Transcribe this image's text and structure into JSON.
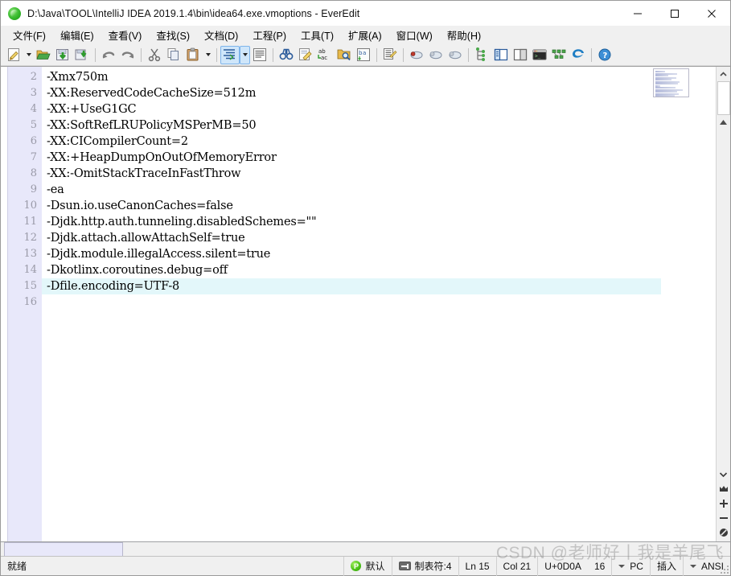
{
  "window": {
    "title": "D:\\Java\\TOOL\\IntelliJ IDEA 2019.1.4\\bin\\idea64.exe.vmoptions - EverEdit",
    "logo_icon": "everedit-green-logo",
    "minimize_label": "─",
    "maximize_label": "□",
    "close_label": "✕"
  },
  "menubar": {
    "items": [
      {
        "label": "文件(F)",
        "name": "menu-file"
      },
      {
        "label": "编辑(E)",
        "name": "menu-edit"
      },
      {
        "label": "查看(V)",
        "name": "menu-view"
      },
      {
        "label": "查找(S)",
        "name": "menu-search"
      },
      {
        "label": "文档(D)",
        "name": "menu-document"
      },
      {
        "label": "工程(P)",
        "name": "menu-project"
      },
      {
        "label": "工具(T)",
        "name": "menu-tools"
      },
      {
        "label": "扩展(A)",
        "name": "menu-extensions"
      },
      {
        "label": "窗口(W)",
        "name": "menu-window"
      },
      {
        "label": "帮助(H)",
        "name": "menu-help"
      }
    ]
  },
  "toolbar": {
    "items": [
      {
        "icon": "new-file-icon",
        "type": "button"
      },
      {
        "icon": "chevron-down-icon",
        "type": "arrow"
      },
      {
        "icon": "open-folder-icon",
        "type": "button"
      },
      {
        "icon": "save-icon",
        "type": "button"
      },
      {
        "icon": "save-as-icon",
        "type": "button"
      },
      {
        "icon": "separator",
        "type": "sep"
      },
      {
        "icon": "undo-icon",
        "type": "button"
      },
      {
        "icon": "redo-icon",
        "type": "button"
      },
      {
        "icon": "separator",
        "type": "sep"
      },
      {
        "icon": "cut-icon",
        "type": "button"
      },
      {
        "icon": "copy-icon",
        "type": "button"
      },
      {
        "icon": "paste-icon",
        "type": "button"
      },
      {
        "icon": "chevron-down-icon",
        "type": "arrow"
      },
      {
        "icon": "separator",
        "type": "sep"
      },
      {
        "icon": "indent-list-icon",
        "type": "button",
        "selected": true
      },
      {
        "icon": "chevron-down-icon",
        "type": "arrow",
        "selected": true
      },
      {
        "icon": "wrap-lines-icon",
        "type": "button"
      },
      {
        "icon": "separator",
        "type": "sep"
      },
      {
        "icon": "find-binoculars-icon",
        "type": "button"
      },
      {
        "icon": "replace-icon",
        "type": "button"
      },
      {
        "icon": "find-replace-abc-icon",
        "type": "button"
      },
      {
        "icon": "find-in-files-icon",
        "type": "button"
      },
      {
        "icon": "sort-ba-icon",
        "type": "button"
      },
      {
        "icon": "separator",
        "type": "sep"
      },
      {
        "icon": "column-mode-icon",
        "type": "button"
      },
      {
        "icon": "separator",
        "type": "sep"
      },
      {
        "icon": "bookmark-add-icon",
        "type": "button"
      },
      {
        "icon": "bookmark-prev-icon",
        "type": "button"
      },
      {
        "icon": "bookmark-next-icon",
        "type": "button"
      },
      {
        "icon": "separator",
        "type": "sep"
      },
      {
        "icon": "outline-tree-icon",
        "type": "button"
      },
      {
        "icon": "explorer-panel-icon",
        "type": "button"
      },
      {
        "icon": "split-panel-icon",
        "type": "button"
      },
      {
        "icon": "console-icon",
        "type": "button"
      },
      {
        "icon": "plugins-icon",
        "type": "button"
      },
      {
        "icon": "browser-icon",
        "type": "button"
      },
      {
        "icon": "separator",
        "type": "sep"
      },
      {
        "icon": "help-icon",
        "type": "button"
      }
    ]
  },
  "editor": {
    "current_line": 15,
    "first_visible_line": 2,
    "lines": [
      {
        "no": "2",
        "text": "-Xmx750m"
      },
      {
        "no": "3",
        "text": "-XX:ReservedCodeCacheSize=512m"
      },
      {
        "no": "4",
        "text": "-XX:+UseG1GC"
      },
      {
        "no": "5",
        "text": "-XX:SoftRefLRUPolicyMSPerMB=50"
      },
      {
        "no": "6",
        "text": "-XX:CICompilerCount=2"
      },
      {
        "no": "7",
        "text": "-XX:+HeapDumpOnOutOfMemoryError"
      },
      {
        "no": "8",
        "text": "-XX:-OmitStackTraceInFastThrow"
      },
      {
        "no": "9",
        "text": "-ea"
      },
      {
        "no": "10",
        "text": "-Dsun.io.useCanonCaches=false"
      },
      {
        "no": "11",
        "text": "-Djdk.http.auth.tunneling.disabledSchemes=\"\""
      },
      {
        "no": "12",
        "text": "-Djdk.attach.allowAttachSelf=true"
      },
      {
        "no": "13",
        "text": "-Djdk.module.illegalAccess.silent=true"
      },
      {
        "no": "14",
        "text": "-Dkotlinx.coroutines.debug=off"
      },
      {
        "no": "15",
        "text": "-Dfile.encoding=UTF-8"
      },
      {
        "no": "16",
        "text": ""
      }
    ]
  },
  "scrollbar": {
    "up_icon": "chevron-up-icon",
    "down_icon": "chevron-down-icon",
    "bookmark_icon": "bookmark-icon",
    "zoom_in_icon": "plus-icon",
    "zoom_out_icon": "minus-icon",
    "reset_icon": "no-entry-icon"
  },
  "tabs": [
    {
      "label": "",
      "name": "doc-tab-vmoptions",
      "active": true
    }
  ],
  "statusbar": {
    "ready_text": "就绪",
    "syntax_icon": "p-green-icon",
    "syntax_label": "默认",
    "tab_icon": "tab-width-icon",
    "tab_label": "制表符:4",
    "line_label": "Ln 15",
    "col_label": "Col 21",
    "unicode_label": "U+0D0A",
    "bytes_label": "16",
    "eol_label": "PC",
    "insert_label": "插入",
    "encoding_label": "ANSI"
  },
  "watermark": {
    "text": "CSDN @老师好丨我是羊尾飞"
  },
  "colors": {
    "gutter_bg": "#e8e8fa",
    "current_line_bg": "#e3f7fa",
    "chrome_bg": "#f0f0f0",
    "selected_toolbar": "#cfe6fa"
  }
}
